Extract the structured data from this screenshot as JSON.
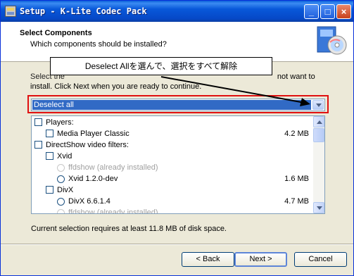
{
  "window": {
    "title": "Setup - K-Lite Codec Pack",
    "controls": {
      "minimize": "_",
      "maximize": "□",
      "close": "×"
    }
  },
  "header": {
    "title": "Select Components",
    "subtitle": "Which components should be installed?",
    "icon": "cd-box-icon"
  },
  "annotation": {
    "callout_text": "Deselect Allを選んで、選択をすべて解除",
    "highlight_color": "#e01010"
  },
  "description": {
    "line1_start": "Select the",
    "line1_end": "not want to",
    "line2": "install. Click Next when you are ready to continue."
  },
  "component_type": {
    "selected": "Deselect all"
  },
  "components": [
    {
      "label": "Players:",
      "control": "checkbox",
      "checked": false,
      "size": "",
      "disabled": false,
      "indent": 0
    },
    {
      "label": "Media Player Classic",
      "control": "checkbox",
      "checked": false,
      "size": "4.2 MB",
      "disabled": false,
      "indent": 1
    },
    {
      "label": "DirectShow video filters:",
      "control": "checkbox",
      "checked": false,
      "size": "",
      "disabled": false,
      "indent": 0
    },
    {
      "label": "Xvid",
      "control": "checkbox",
      "checked": false,
      "size": "",
      "disabled": false,
      "indent": 1
    },
    {
      "label": "ffdshow (already installed)",
      "control": "radio",
      "checked": false,
      "size": "",
      "disabled": true,
      "indent": 2
    },
    {
      "label": "Xvid 1.2.0-dev",
      "control": "radio",
      "checked": false,
      "size": "1.6 MB",
      "disabled": false,
      "indent": 2
    },
    {
      "label": "DivX",
      "control": "checkbox",
      "checked": false,
      "size": "",
      "disabled": false,
      "indent": 1
    },
    {
      "label": "DivX 6.6.1.4",
      "control": "radio",
      "checked": false,
      "size": "4.7 MB",
      "disabled": false,
      "indent": 2
    },
    {
      "label": "ffdshow (already installed)",
      "control": "radio",
      "checked": false,
      "size": "",
      "disabled": true,
      "indent": 2
    }
  ],
  "status": {
    "requirement": "Current selection requires at least 11.8 MB of disk space."
  },
  "buttons": {
    "back": "< Back",
    "next": "Next >",
    "cancel": "Cancel"
  },
  "colors": {
    "titlebar": "#0858d9",
    "selection": "#316ac5",
    "highlight_border": "#e01010"
  }
}
